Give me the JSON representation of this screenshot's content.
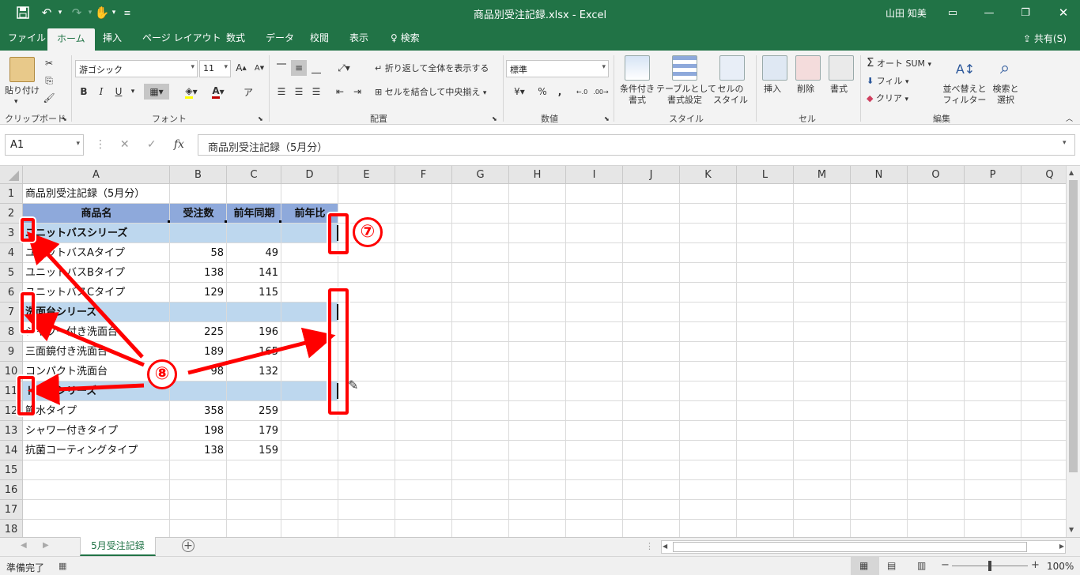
{
  "titlebar": {
    "title": "商品別受注記録.xlsx  -  Excel",
    "user": "山田 知美"
  },
  "tabs": [
    "ファイル",
    "ホーム",
    "挿入",
    "ページ レイアウト",
    "数式",
    "データ",
    "校閲",
    "表示",
    "検索"
  ],
  "active_tab": "ホーム",
  "share_label": "共有(S)",
  "ribbon": {
    "clipboard": {
      "paste": "貼り付け",
      "label": "クリップボード"
    },
    "font": {
      "name": "游ゴシック",
      "size": "11",
      "bold": "B",
      "italic": "I",
      "underline": "U",
      "label": "フォント"
    },
    "alignment": {
      "wrap": "折り返して全体を表示する",
      "merge": "セルを結合して中央揃え",
      "label": "配置"
    },
    "number": {
      "format": "標準",
      "percent": "%",
      "label": "数値"
    },
    "styles": {
      "conditional": "条件付き\n書式",
      "table": "テーブルとして\n書式設定",
      "cell": "セルの\nスタイル",
      "label": "スタイル"
    },
    "cells": {
      "insert": "挿入",
      "delete": "削除",
      "format": "書式",
      "label": "セル"
    },
    "editing": {
      "autosum": "オート SUM",
      "fill": "フィル",
      "clear": "クリア",
      "sort": "並べ替えと\nフィルター",
      "find": "検索と\n選択",
      "label": "編集"
    }
  },
  "formula_bar": {
    "name_box": "A1",
    "formula": "商品別受注記録（5月分）"
  },
  "columns": [
    "A",
    "B",
    "C",
    "D",
    "E",
    "F",
    "G",
    "H",
    "I",
    "J",
    "K",
    "L",
    "M",
    "N",
    "O",
    "P",
    "Q"
  ],
  "rows": [
    "1",
    "2",
    "3",
    "4",
    "5",
    "6",
    "7",
    "8",
    "9",
    "10",
    "11",
    "12",
    "13",
    "14",
    "15",
    "16",
    "17",
    "18"
  ],
  "sheet": {
    "title_cell": "商品別受注記録（5月分）",
    "headers": [
      "商品名",
      "受注数",
      "前年同期",
      "前年比"
    ],
    "data": [
      {
        "row": 3,
        "a": "ユニットバスシリーズ",
        "b": "",
        "c": "",
        "category": true
      },
      {
        "row": 4,
        "a": "ユニットバスAタイプ",
        "b": "58",
        "c": "49"
      },
      {
        "row": 5,
        "a": "ユニットバスBタイプ",
        "b": "138",
        "c": "141"
      },
      {
        "row": 6,
        "a": "ユニットバスCタイプ",
        "b": "129",
        "c": "115"
      },
      {
        "row": 7,
        "a": "洗面台シリーズ",
        "b": "",
        "c": "",
        "category": true
      },
      {
        "row": 8,
        "a": "シャワー付き洗面台",
        "b": "225",
        "c": "196"
      },
      {
        "row": 9,
        "a": "三面鏡付き洗面台",
        "b": "189",
        "c": "165"
      },
      {
        "row": 10,
        "a": "コンパクト洗面台",
        "b": "98",
        "c": "132"
      },
      {
        "row": 11,
        "a": "トイレシリーズ",
        "b": "",
        "c": "",
        "category": true
      },
      {
        "row": 12,
        "a": "節水タイプ",
        "b": "358",
        "c": "259"
      },
      {
        "row": 13,
        "a": "シャワー付きタイプ",
        "b": "198",
        "c": "179"
      },
      {
        "row": 14,
        "a": "抗菌コーティングタイプ",
        "b": "138",
        "c": "159"
      }
    ]
  },
  "sheet_tab": "5月受注記録",
  "status": {
    "ready": "準備完了",
    "zoom": "100%"
  },
  "annotations": {
    "seven": "⑦",
    "eight": "⑧"
  },
  "colors": {
    "brand": "#217346",
    "header_fill": "#8ea9db",
    "category_fill": "#bdd7ee",
    "annotation": "#ff0000"
  }
}
